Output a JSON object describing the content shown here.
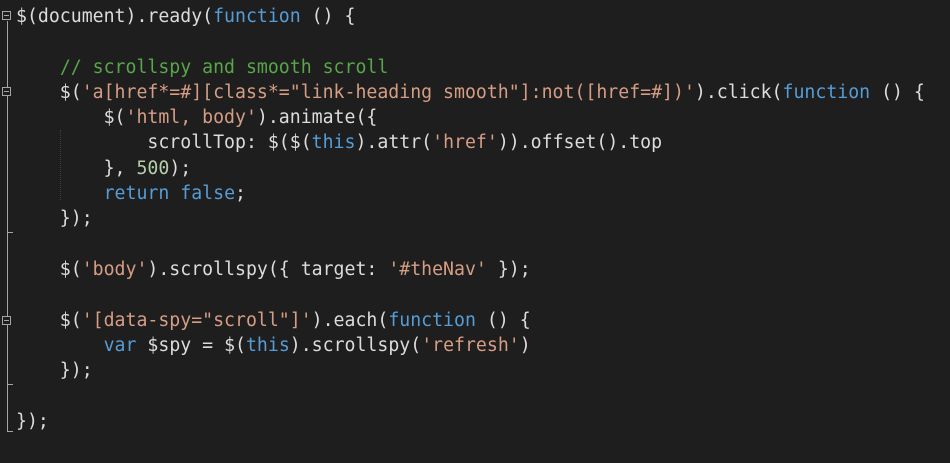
{
  "colors": {
    "background": "#1e1e1e",
    "default": "#dcdcdc",
    "keyword": "#569cd6",
    "string": "#d69d85",
    "comment": "#57a64a",
    "number": "#b5cea8",
    "fold_marker": "#a5a5a5"
  },
  "code_lines": [
    [
      {
        "t": "$(document).ready(",
        "c": "default"
      },
      {
        "t": "function",
        "c": "keyword"
      },
      {
        "t": " () {",
        "c": "default"
      }
    ],
    [],
    [
      {
        "t": "    ",
        "c": "default"
      },
      {
        "t": "// scrollspy and smooth scroll",
        "c": "comment"
      }
    ],
    [
      {
        "t": "    $(",
        "c": "default"
      },
      {
        "t": "'a[href*=#][class*=\"link-heading smooth\"]:not([href=#])'",
        "c": "string"
      },
      {
        "t": ").click(",
        "c": "default"
      },
      {
        "t": "function",
        "c": "keyword"
      },
      {
        "t": " () {",
        "c": "default"
      }
    ],
    [
      {
        "t": "        $(",
        "c": "default"
      },
      {
        "t": "'html, body'",
        "c": "string"
      },
      {
        "t": ").animate({",
        "c": "default"
      }
    ],
    [
      {
        "t": "            scrollTop: $($(",
        "c": "default"
      },
      {
        "t": "this",
        "c": "keyword"
      },
      {
        "t": ").attr(",
        "c": "default"
      },
      {
        "t": "'href'",
        "c": "string"
      },
      {
        "t": ")).offset().top",
        "c": "default"
      }
    ],
    [
      {
        "t": "        }, ",
        "c": "default"
      },
      {
        "t": "500",
        "c": "number"
      },
      {
        "t": ");",
        "c": "default"
      }
    ],
    [
      {
        "t": "        ",
        "c": "default"
      },
      {
        "t": "return",
        "c": "keyword"
      },
      {
        "t": " ",
        "c": "default"
      },
      {
        "t": "false",
        "c": "keyword"
      },
      {
        "t": ";",
        "c": "default"
      }
    ],
    [
      {
        "t": "    });",
        "c": "default"
      }
    ],
    [],
    [
      {
        "t": "    $(",
        "c": "default"
      },
      {
        "t": "'body'",
        "c": "string"
      },
      {
        "t": ").scrollspy({ target: ",
        "c": "default"
      },
      {
        "t": "'#theNav'",
        "c": "string"
      },
      {
        "t": " });",
        "c": "default"
      }
    ],
    [],
    [
      {
        "t": "    $(",
        "c": "default"
      },
      {
        "t": "'[data-spy=\"scroll\"]'",
        "c": "string"
      },
      {
        "t": ").each(",
        "c": "default"
      },
      {
        "t": "function",
        "c": "keyword"
      },
      {
        "t": " () {",
        "c": "default"
      }
    ],
    [
      {
        "t": "        ",
        "c": "default"
      },
      {
        "t": "var",
        "c": "keyword"
      },
      {
        "t": " $spy = $(",
        "c": "default"
      },
      {
        "t": "this",
        "c": "keyword"
      },
      {
        "t": ").scrollspy(",
        "c": "default"
      },
      {
        "t": "'refresh'",
        "c": "string"
      },
      {
        "t": ")",
        "c": "default"
      }
    ],
    [
      {
        "t": "    });",
        "c": "default"
      }
    ],
    [],
    [
      {
        "t": "});",
        "c": "default"
      }
    ]
  ]
}
